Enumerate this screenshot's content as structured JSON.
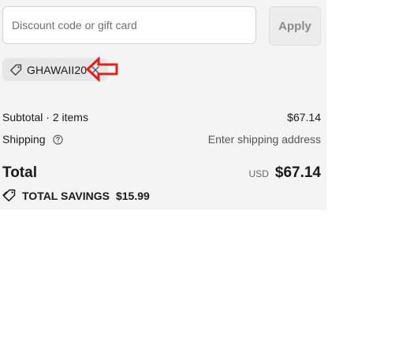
{
  "discount": {
    "placeholder": "Discount code or gift card",
    "value": "",
    "apply_label": "Apply"
  },
  "applied_code": {
    "code": "GHAWAII20",
    "tag_icon": "tag-icon",
    "remove_icon": "close-icon"
  },
  "annotation": {
    "icon": "red-arrow-left",
    "color": "#e0201f"
  },
  "summary": {
    "subtotal_label": "Subtotal · 2 items",
    "subtotal_value": "$67.14",
    "shipping_label": "Shipping",
    "shipping_help_icon": "help-icon",
    "shipping_value": "Enter shipping address",
    "total_label": "Total",
    "total_currency": "USD",
    "total_value": "$67.14",
    "savings_icon": "tags-icon",
    "savings_label": "TOTAL SAVINGS",
    "savings_value": "$15.99"
  }
}
